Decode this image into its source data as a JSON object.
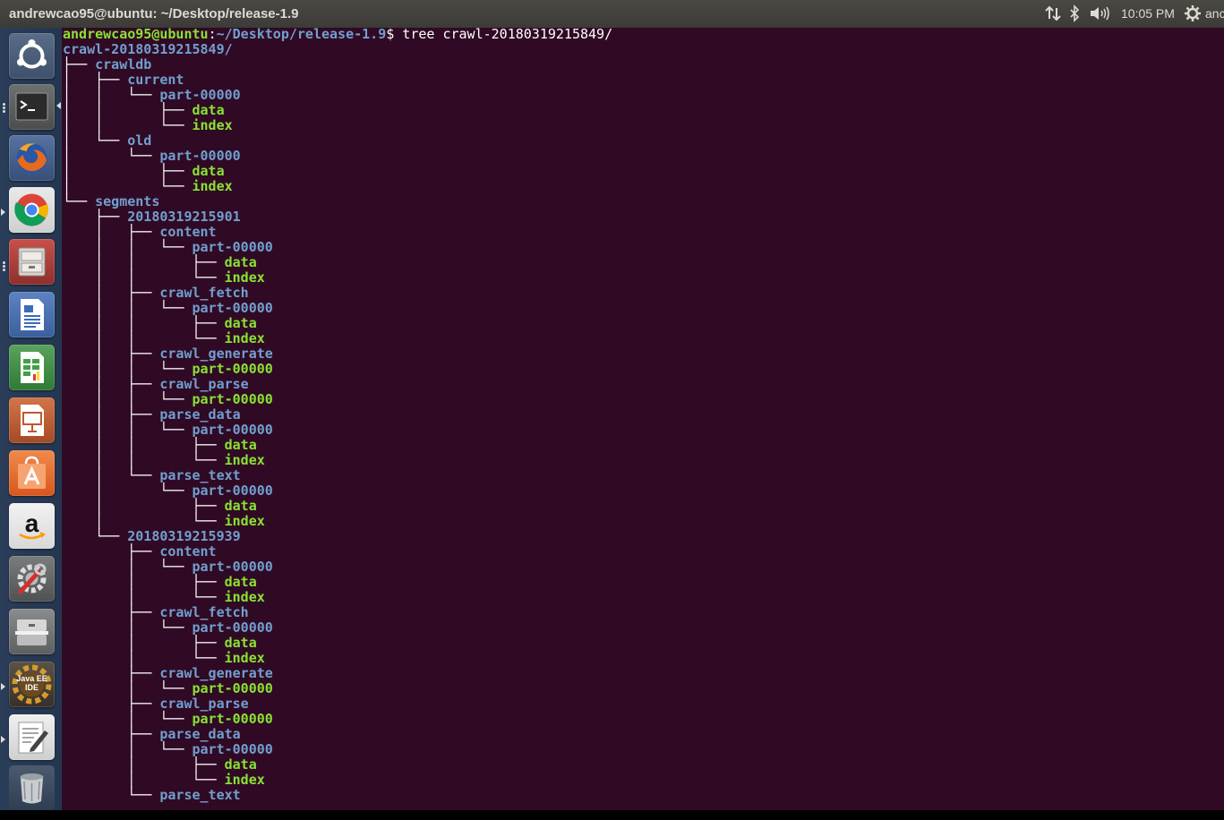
{
  "topbar": {
    "title": "andrewcao95@ubuntu: ~/Desktop/release-1.9",
    "clock": "10:05 PM",
    "user": "anc",
    "indicators": [
      "network-icon",
      "bluetooth-icon",
      "volume-icon",
      "gear-icon"
    ]
  },
  "launcher": {
    "items": [
      {
        "name": "ubuntu-dash",
        "icon": "ubuntu-logo-icon"
      },
      {
        "name": "terminal",
        "icon": "terminal-icon",
        "running": true
      },
      {
        "name": "firefox",
        "icon": "firefox-icon"
      },
      {
        "name": "chrome",
        "icon": "chrome-icon",
        "running": true
      },
      {
        "name": "files",
        "icon": "file-cabinet-icon",
        "running": true
      },
      {
        "name": "libreoffice-writer",
        "icon": "writer-icon"
      },
      {
        "name": "libreoffice-calc",
        "icon": "calc-icon"
      },
      {
        "name": "libreoffice-impress",
        "icon": "impress-icon"
      },
      {
        "name": "software-center",
        "icon": "shopping-bag-icon"
      },
      {
        "name": "amazon",
        "icon": "amazon-icon"
      },
      {
        "name": "system-settings",
        "icon": "wrench-gear-icon"
      },
      {
        "name": "archive",
        "icon": "drawer-icon"
      },
      {
        "name": "eclipse-java-ee",
        "icon": "java-ee-ide-icon",
        "label": "Java EE IDE",
        "running": true
      },
      {
        "name": "text-editor",
        "icon": "text-editor-icon",
        "running": true
      },
      {
        "name": "trash",
        "icon": "trash-icon"
      }
    ]
  },
  "terminal": {
    "prompt": {
      "user_host": "andrewcao95@ubuntu",
      "sep": ":",
      "path": "~/Desktop/release-1.9",
      "dollar": "$",
      "command": " tree crawl-20180319215849/"
    },
    "lines": [
      {
        "p": "",
        "t": "crawl-20180319215849/",
        "k": "dir"
      },
      {
        "p": "├── ",
        "t": "crawldb",
        "k": "dir"
      },
      {
        "p": "│   ├── ",
        "t": "current",
        "k": "dir"
      },
      {
        "p": "│   │   └── ",
        "t": "part-00000",
        "k": "dir"
      },
      {
        "p": "│   │       ├── ",
        "t": "data",
        "k": "file"
      },
      {
        "p": "│   │       └── ",
        "t": "index",
        "k": "file"
      },
      {
        "p": "│   └── ",
        "t": "old",
        "k": "dir"
      },
      {
        "p": "│       └── ",
        "t": "part-00000",
        "k": "dir"
      },
      {
        "p": "│           ├── ",
        "t": "data",
        "k": "file"
      },
      {
        "p": "│           └── ",
        "t": "index",
        "k": "file"
      },
      {
        "p": "└── ",
        "t": "segments",
        "k": "dir"
      },
      {
        "p": "    ├── ",
        "t": "20180319215901",
        "k": "dir"
      },
      {
        "p": "    │   ├── ",
        "t": "content",
        "k": "dir"
      },
      {
        "p": "    │   │   └── ",
        "t": "part-00000",
        "k": "dir"
      },
      {
        "p": "    │   │       ├── ",
        "t": "data",
        "k": "file"
      },
      {
        "p": "    │   │       └── ",
        "t": "index",
        "k": "file"
      },
      {
        "p": "    │   ├── ",
        "t": "crawl_fetch",
        "k": "dir"
      },
      {
        "p": "    │   │   └── ",
        "t": "part-00000",
        "k": "dir"
      },
      {
        "p": "    │   │       ├── ",
        "t": "data",
        "k": "file"
      },
      {
        "p": "    │   │       └── ",
        "t": "index",
        "k": "file"
      },
      {
        "p": "    │   ├── ",
        "t": "crawl_generate",
        "k": "dir"
      },
      {
        "p": "    │   │   └── ",
        "t": "part-00000",
        "k": "file"
      },
      {
        "p": "    │   ├── ",
        "t": "crawl_parse",
        "k": "dir"
      },
      {
        "p": "    │   │   └── ",
        "t": "part-00000",
        "k": "file"
      },
      {
        "p": "    │   ├── ",
        "t": "parse_data",
        "k": "dir"
      },
      {
        "p": "    │   │   └── ",
        "t": "part-00000",
        "k": "dir"
      },
      {
        "p": "    │   │       ├── ",
        "t": "data",
        "k": "file"
      },
      {
        "p": "    │   │       └── ",
        "t": "index",
        "k": "file"
      },
      {
        "p": "    │   └── ",
        "t": "parse_text",
        "k": "dir"
      },
      {
        "p": "    │       └── ",
        "t": "part-00000",
        "k": "dir"
      },
      {
        "p": "    │           ├── ",
        "t": "data",
        "k": "file"
      },
      {
        "p": "    │           └── ",
        "t": "index",
        "k": "file"
      },
      {
        "p": "    └── ",
        "t": "20180319215939",
        "k": "dir"
      },
      {
        "p": "        ├── ",
        "t": "content",
        "k": "dir"
      },
      {
        "p": "        │   └── ",
        "t": "part-00000",
        "k": "dir"
      },
      {
        "p": "        │       ├── ",
        "t": "data",
        "k": "file"
      },
      {
        "p": "        │       └── ",
        "t": "index",
        "k": "file"
      },
      {
        "p": "        ├── ",
        "t": "crawl_fetch",
        "k": "dir"
      },
      {
        "p": "        │   └── ",
        "t": "part-00000",
        "k": "dir"
      },
      {
        "p": "        │       ├── ",
        "t": "data",
        "k": "file"
      },
      {
        "p": "        │       └── ",
        "t": "index",
        "k": "file"
      },
      {
        "p": "        ├── ",
        "t": "crawl_generate",
        "k": "dir"
      },
      {
        "p": "        │   └── ",
        "t": "part-00000",
        "k": "file"
      },
      {
        "p": "        ├── ",
        "t": "crawl_parse",
        "k": "dir"
      },
      {
        "p": "        │   └── ",
        "t": "part-00000",
        "k": "file"
      },
      {
        "p": "        ├── ",
        "t": "parse_data",
        "k": "dir"
      },
      {
        "p": "        │   └── ",
        "t": "part-00000",
        "k": "dir"
      },
      {
        "p": "        │       ├── ",
        "t": "data",
        "k": "file"
      },
      {
        "p": "        │       └── ",
        "t": "index",
        "k": "file"
      },
      {
        "p": "        └── ",
        "t": "parse_text",
        "k": "dir"
      }
    ]
  },
  "colors": {
    "terminal_bg": "#300a24",
    "prompt_user": "#8ae234",
    "prompt_path": "#729fcf",
    "directory": "#729fcf",
    "file": "#8ae234",
    "launcher_bg": "#2a3d59",
    "panel_bg": "#3c3b37"
  }
}
